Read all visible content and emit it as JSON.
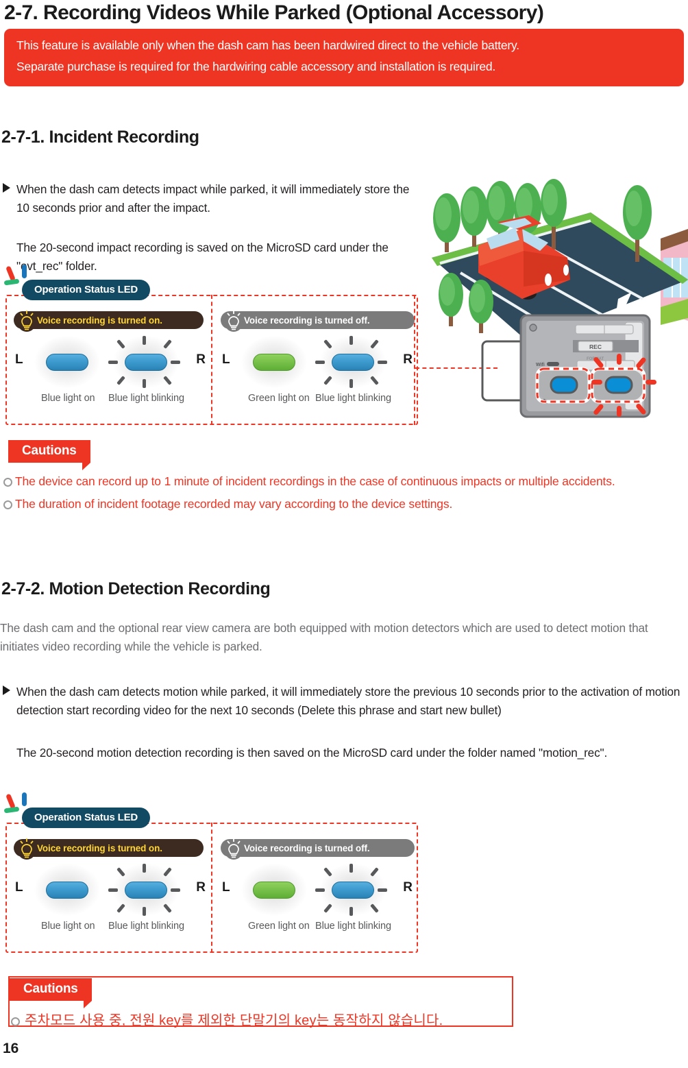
{
  "document": {
    "chapter_title": "2-7. Recording Videos While Parked (Optional Accessory)",
    "page_number": "16"
  },
  "notice": {
    "line1": "This feature is available only when the dash cam  has been hardwired direct to the vehicle battery.",
    "line2": "Separate purchase is required for the hardwiring cable accessory and installation is required.",
    "bg_color": "#ee3524",
    "text_color": "#ffffff"
  },
  "section_incident": {
    "heading": "2-7-1. Incident Recording",
    "bullet1": "When the dash cam  detects impact while parked, it will immediately store the 10 seconds prior and after the impact.",
    "bullet2": "The 20-second impact recording is saved on the MicroSD card under the \"evt_rec\" folder."
  },
  "cautions_1": {
    "tag": "Cautions",
    "items": [
      "The device can record up to 1 minute of incident recordings in the case of continuous impacts or multiple accidents.",
      "The duration of incident footage recorded may vary according to the device settings."
    ],
    "color": "#ee3524"
  },
  "section_motion": {
    "heading": "2-7-2. Motion Detection Recording",
    "intro": "The dash cam and the optional rear view camera are both equipped with motion detectors which are used to detect motion that initiates video recording while the vehicle is parked.",
    "bullet1": "When the dash cam detects motion while parked, it will immediately store the previous 10 seconds prior to the activation of motion detection start recording video for the next 10 seconds (Delete this phrase and start new bullet)",
    "bullet2": "The 20-second motion detection recording is then saved on the MicroSD card under the folder named \"motion_rec\"."
  },
  "cautions_2": {
    "tag": "Cautions",
    "item_korean": "주차모드 사용 중, 전원 key를 제외한 단말기의 key는 동작하지 않습니다."
  },
  "led_panel": {
    "badge": "Operation Status LED",
    "badge_color": "#134a63",
    "frame_color": "#ee3524",
    "left_group": {
      "voice_label": "Voice recording is turned on.",
      "voice_bg": "#3d2b21",
      "voice_text_color": "#ffd633",
      "side_left": "L",
      "side_right": "R",
      "led_a_caption": "Blue light on",
      "led_a_color": "#3e9bcf",
      "led_b_caption": "Blue light blinking",
      "led_b_color": "#3e9bcf"
    },
    "right_group": {
      "voice_label": "Voice recording is turned off.",
      "voice_bg": "#7b7b7b",
      "voice_text_color": "#ffffff",
      "side_left": "L",
      "side_right": "R",
      "led_a_caption": "Green light on",
      "led_a_color": "#79c24b",
      "led_b_caption": "Blue light blinking",
      "led_b_color": "#3e9bcf"
    }
  },
  "illustration": {
    "device_rec_label": "REC",
    "device_format_label": "FORMAT",
    "device_wifi_label": "Wifi"
  }
}
